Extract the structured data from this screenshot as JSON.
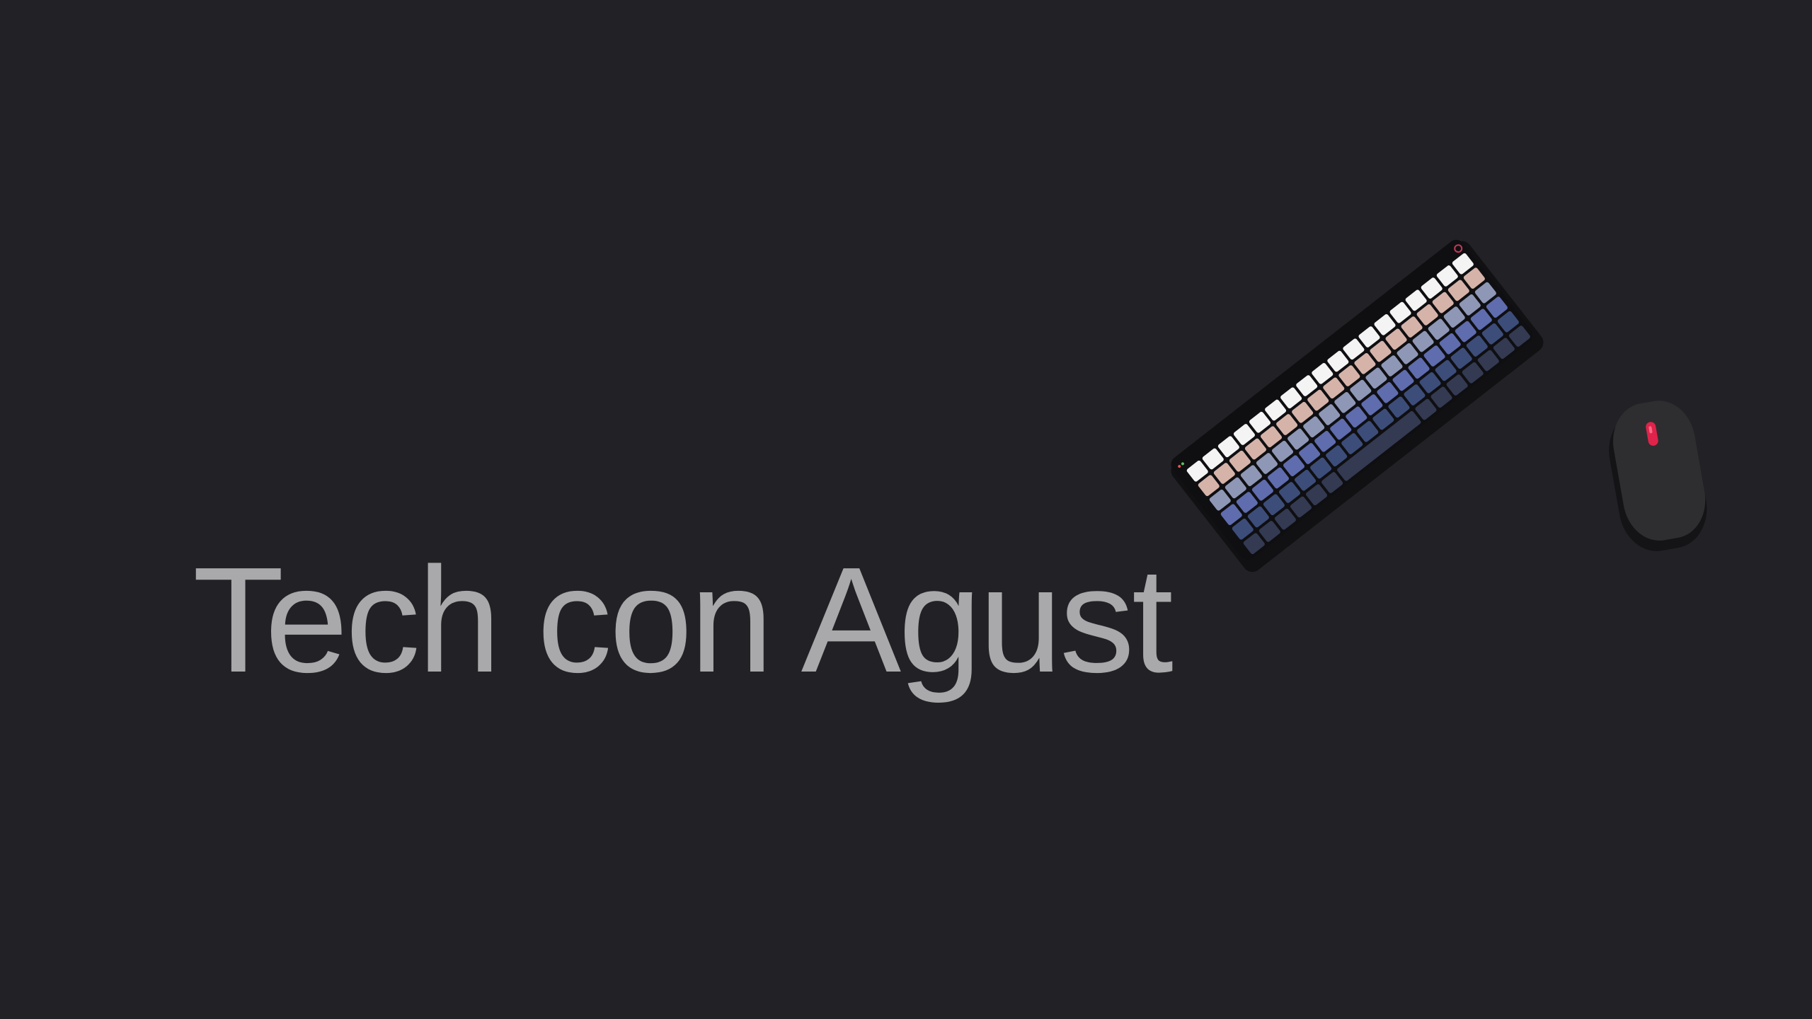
{
  "title": {
    "text": "Tech con Agust"
  },
  "illustration": {
    "keyboard_icon": "keyboard-icon",
    "mouse_icon": "mouse-icon",
    "key_row_colors": [
      "#f4f4f4",
      "#d6b3a9",
      "#8f97b6",
      "#5f6cae",
      "#3d4d7a",
      "#333a52"
    ],
    "keyboard_body_color": "#0f0f12",
    "mouse_body_color": "#2e2e31",
    "mouse_wheel_color": "#e0234a"
  },
  "colors": {
    "background": "#222226",
    "title_text": "#a9a9ab"
  }
}
